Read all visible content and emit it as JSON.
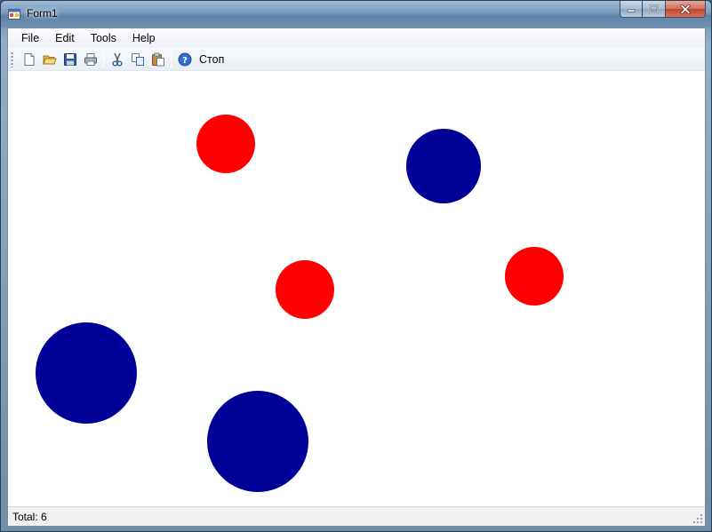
{
  "window": {
    "title": "Form1",
    "controls": [
      "minimize",
      "maximize",
      "close"
    ]
  },
  "menu": {
    "items": [
      {
        "label": "File"
      },
      {
        "label": "Edit"
      },
      {
        "label": "Tools"
      },
      {
        "label": "Help"
      }
    ]
  },
  "toolbar": {
    "buttons": [
      {
        "icon": "new-document-icon"
      },
      {
        "icon": "open-folder-icon"
      },
      {
        "icon": "save-icon"
      },
      {
        "icon": "print-icon"
      },
      {
        "icon": "cut-icon"
      },
      {
        "icon": "copy-icon"
      },
      {
        "icon": "paste-icon"
      },
      {
        "icon": "help-icon"
      }
    ],
    "stop_label": "Стоп"
  },
  "circles": [
    {
      "color": "#ff0000",
      "shape": "circle"
    },
    {
      "color": "#000099",
      "shape": "circle"
    },
    {
      "color": "#ff0000",
      "shape": "circle"
    },
    {
      "color": "#ff0000",
      "shape": "circle"
    },
    {
      "color": "#000099",
      "shape": "circle"
    },
    {
      "color": "#000099",
      "shape": "circle"
    }
  ],
  "status": {
    "text": "Total: 6"
  },
  "colors": {
    "red": "#ff0000",
    "blue": "#000099"
  }
}
